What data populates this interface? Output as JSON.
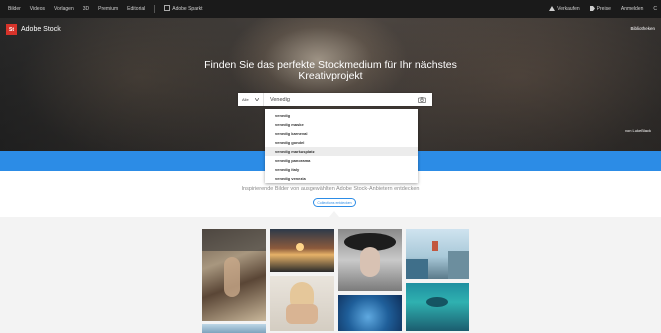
{
  "topnav": {
    "items": [
      "Bilder",
      "Videos",
      "Vorlagen",
      "3D",
      "Premium",
      "Editorial"
    ],
    "adobe_sparx": "Adobe Sparkt",
    "right": [
      "Verkaufen",
      "Preise",
      "Anmelden",
      "C"
    ]
  },
  "hero": {
    "logo_mark": "St",
    "logo_text": "Adobe Stock",
    "library_link": "Bibliotheken",
    "headline_line1": "Finden Sie das perfekte Stockmedium für Ihr nächstes",
    "headline_line2": "Kreativprojekt",
    "credit": "von LukeBlack"
  },
  "search": {
    "filter_label": "Alle",
    "value": "Venedig",
    "camera_icon": "camera-icon"
  },
  "suggestions": [
    "venedig",
    "venedig maske",
    "venedig karneval",
    "venedig gondel",
    "venedig markusplatz",
    "venedig panorama",
    "venedig italy",
    "venedig venezia"
  ],
  "highlighted_suggestion": 4,
  "section": {
    "tagline": "Inspirierende Bilder von ausgewählten Adobe Stock-Anbietern entdecken",
    "collections_button": "Collections entdecken"
  },
  "colors": {
    "accent": "#2c8ce6",
    "logo_red": "#d7332a",
    "nav_bg": "#1a1a1a"
  }
}
